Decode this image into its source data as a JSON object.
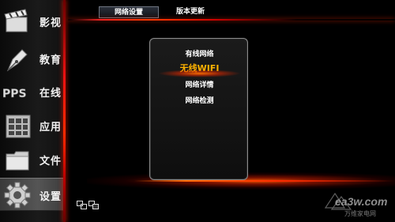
{
  "sidebar": {
    "items": [
      {
        "label": "影视",
        "icon": "clapperboard-icon"
      },
      {
        "label": "教育",
        "icon": "pen-nib-icon"
      },
      {
        "label": "在线",
        "icon": "pps-logo-icon"
      },
      {
        "label": "应用",
        "icon": "app-grid-icon"
      },
      {
        "label": "文件",
        "icon": "folder-icon"
      },
      {
        "label": "设置",
        "icon": "gear-icon",
        "active": true
      }
    ],
    "pps_logo_text": "PPS"
  },
  "tabs": [
    {
      "label": "网络设置",
      "active": true
    },
    {
      "label": "版本更新",
      "active": false
    }
  ],
  "menu": {
    "items": [
      {
        "label": "有线网络"
      },
      {
        "label": "无线WIFI",
        "selected": true
      },
      {
        "label": "网络详情"
      },
      {
        "label": "网络检测"
      }
    ]
  },
  "status_icons": [
    "network-icon",
    "network-connected-icon"
  ],
  "watermark": {
    "domain": "ea3w.com",
    "name": "万维家电网"
  },
  "colors": {
    "accent_red": "#ff2a00",
    "selected_text": "#ffb300"
  }
}
